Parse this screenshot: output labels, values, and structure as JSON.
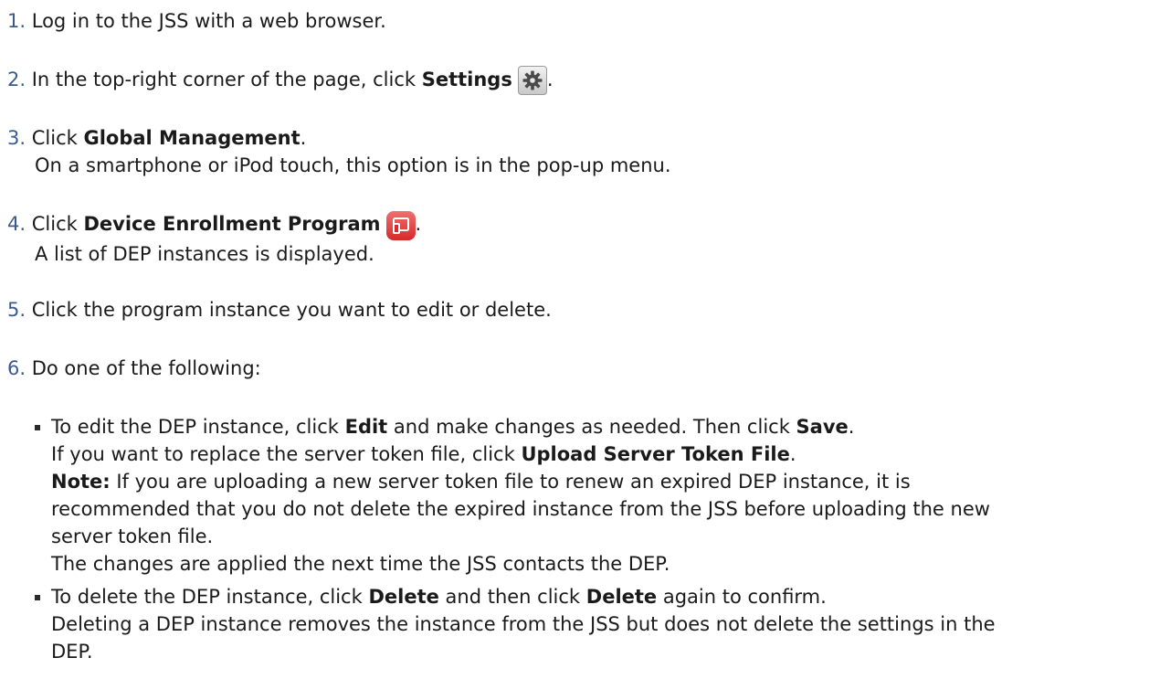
{
  "steps": [
    {
      "num": "1.",
      "text": "Log in to the JSS with a web browser."
    },
    {
      "num": "2.",
      "pre": "In the top-right corner of the page, click ",
      "bold": "Settings",
      "post": ".",
      "icon": "gear-icon"
    },
    {
      "num": "3.",
      "pre": "Click ",
      "bold": "Global Management",
      "post": ".",
      "sub": "On a smartphone or iPod touch, this option is in the pop-up menu."
    },
    {
      "num": "4.",
      "pre": "Click ",
      "bold": "Device Enrollment Program",
      "post": ".",
      "icon": "device-enrollment-icon",
      "sub": "A list of DEP instances is displayed."
    },
    {
      "num": "5.",
      "text": "Click the program instance you want to edit or delete."
    },
    {
      "num": "6.",
      "text": "Do one of the following:"
    }
  ],
  "bullets": [
    {
      "l1_a": "To edit the DEP instance, click ",
      "l1_b": "Edit",
      "l1_c": " and make changes as needed. Then click ",
      "l1_d": "Save",
      "l1_e": ".",
      "l2_a": "If you want to replace the server token file, click ",
      "l2_b": "Upload Server Token File",
      "l2_c": ".",
      "note_label": "Note:",
      "note_l1": " If you are uploading a new server token file to renew an expired DEP instance, it is",
      "note_l2": "recommended that you do not delete the expired instance from the JSS before uploading the new",
      "note_l3": "server token file.",
      "l6": "The changes are applied the next time the JSS contacts the DEP."
    },
    {
      "l1_a": "To delete the DEP instance, click ",
      "l1_b": "Delete",
      "l1_c": " and then click ",
      "l1_d": "Delete",
      "l1_e": " again to confirm.",
      "l2": "Deleting a DEP instance removes the instance from the JSS but does not delete the settings in the",
      "l3": "DEP."
    }
  ]
}
